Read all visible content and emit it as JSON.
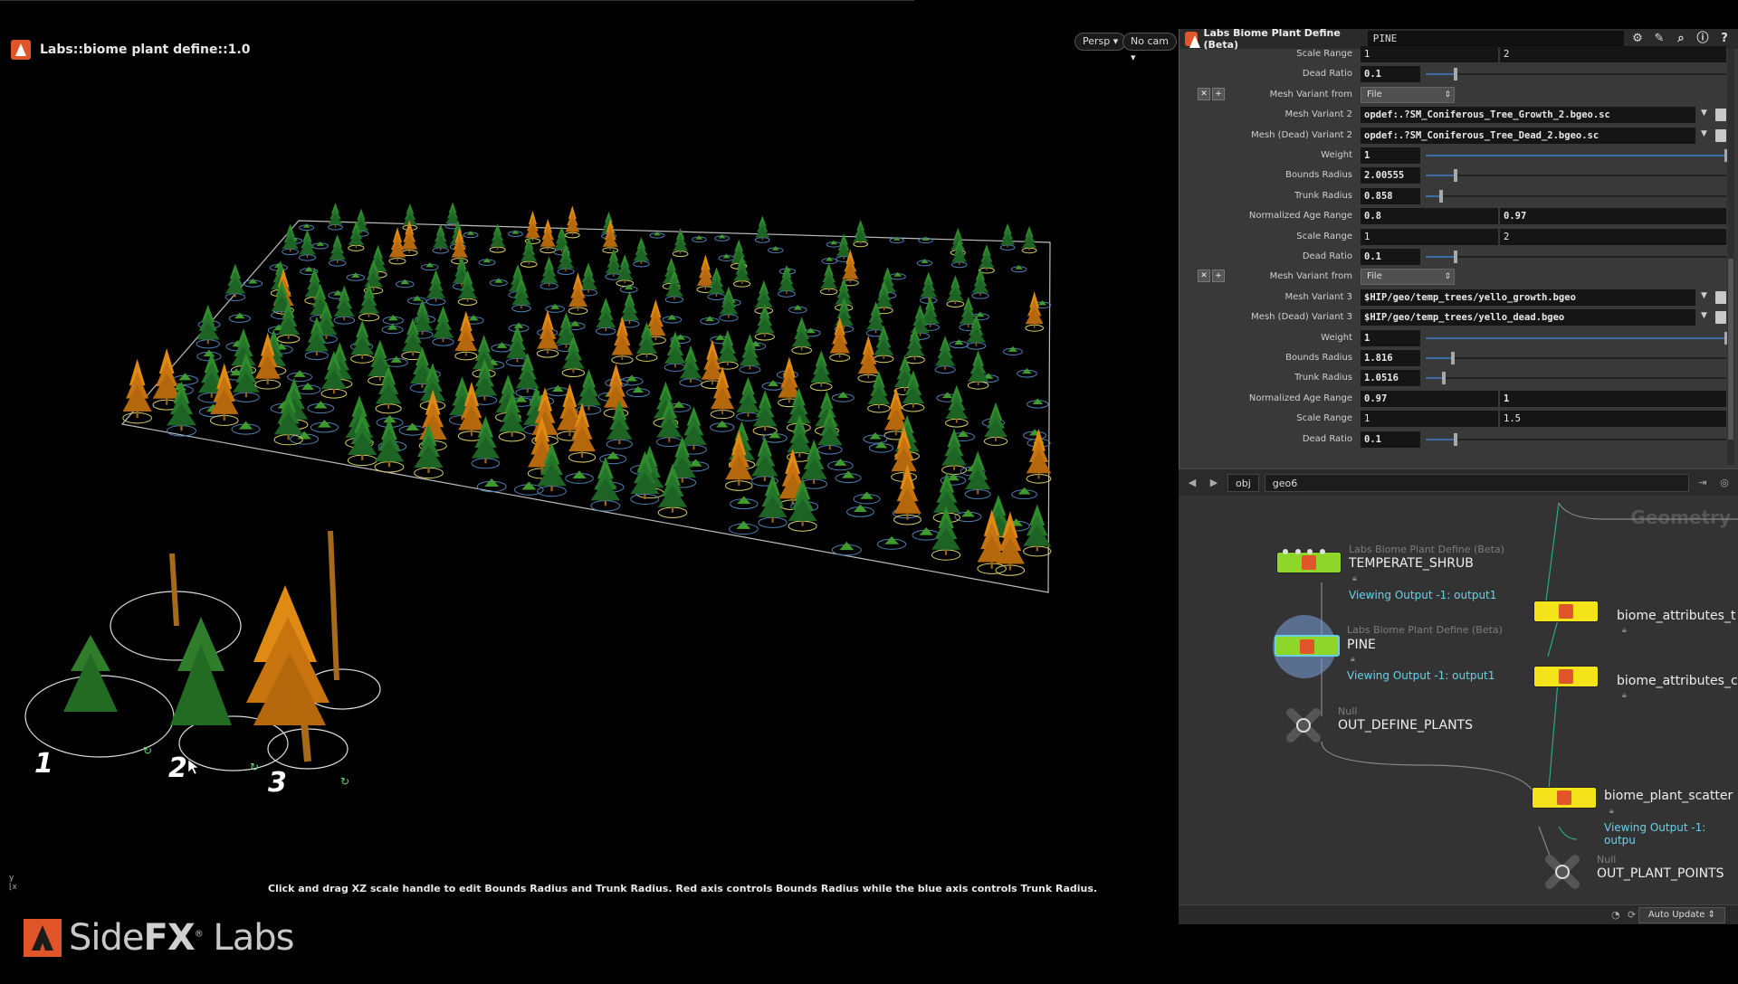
{
  "viewport": {
    "title": "Labs::biome plant define::1.0",
    "persp_label": "Persp",
    "cam_label": "No cam",
    "hint": "Click and drag XZ scale handle to edit Bounds Radius and Trunk Radius. Red axis controls Bounds Radius while the blue axis controls Trunk Radius.",
    "digits": [
      "1",
      "2",
      "3"
    ],
    "axis_y": "y",
    "axis_x": "x"
  },
  "param_panel": {
    "node_type": "Labs Biome Plant Define (Beta)",
    "node_name": "PINE",
    "icons": [
      "gear-icon",
      "brush-icon",
      "search-icon",
      "info-icon",
      "help-icon"
    ],
    "rows": [
      {
        "label": "Scale Range",
        "v1": "1",
        "v2": "2"
      },
      {
        "label": "Dead Ratio",
        "v1": "0.1",
        "slider": 0.1
      },
      {
        "label": "Mesh Variant from",
        "combo": "File"
      },
      {
        "label": "Mesh Variant 2",
        "path": "opdef:.?SM_Coniferous_Tree_Growth_2.bgeo.sc"
      },
      {
        "label": "Mesh (Dead) Variant 2",
        "path": "opdef:.?SM_Coniferous_Tree_Dead_2.bgeo.sc"
      },
      {
        "label": "Weight",
        "v1": "1",
        "slider": 1.0
      },
      {
        "label": "Bounds Radius",
        "v1": "2.00555",
        "slider": 0.1
      },
      {
        "label": "Trunk Radius",
        "v1": "0.858",
        "slider": 0.05
      },
      {
        "label": "Normalized Age Range",
        "v1": "0.8",
        "v2": "0.97"
      },
      {
        "label": "Scale Range",
        "v1": "1",
        "v2": "2"
      },
      {
        "label": "Dead Ratio",
        "v1": "0.1",
        "slider": 0.1
      },
      {
        "label": "Mesh Variant from",
        "combo": "File"
      },
      {
        "label": "Mesh Variant 3",
        "path": "$HIP/geo/temp_trees/yello_growth.bgeo"
      },
      {
        "label": "Mesh (Dead) Variant 3",
        "path": "$HIP/geo/temp_trees/yello_dead.bgeo"
      },
      {
        "label": "Weight",
        "v1": "1",
        "slider": 1.0
      },
      {
        "label": "Bounds Radius",
        "v1": "1.816",
        "slider": 0.09
      },
      {
        "label": "Trunk Radius",
        "v1": "1.0516",
        "slider": 0.06
      },
      {
        "label": "Normalized Age Range",
        "v1": "0.97",
        "v2": "1"
      },
      {
        "label": "Scale Range",
        "v1": "1",
        "v2": "1.5"
      },
      {
        "label": "Dead Ratio",
        "v1": "0.1",
        "slider": 0.1
      }
    ]
  },
  "net_path": {
    "obj": "obj",
    "geo": "geo6"
  },
  "network": {
    "ghost_label": "Geometry",
    "nodes": {
      "shrub": {
        "type": "Labs Biome Plant Define (Beta)",
        "name": "TEMPERATE_SHRUB",
        "viewing": "Viewing Output -1: output1"
      },
      "pine": {
        "type": "Labs Biome Plant Define (Beta)",
        "name": "PINE",
        "viewing": "Viewing Output -1: output1"
      },
      "out_define": {
        "type": "Null",
        "name": "OUT_DEFINE_PLANTS"
      },
      "attrs1": {
        "name": "biome_attributes_t"
      },
      "attrs2": {
        "name": "biome_attributes_c"
      },
      "scatter": {
        "name": "biome_plant_scatter",
        "viewing": "Viewing Output -1: outpu"
      },
      "out_points": {
        "type": "Null",
        "name": "OUT_PLANT_POINTS"
      }
    }
  },
  "statusbar": {
    "auto_update": "Auto Update"
  },
  "brand": {
    "side": "Side",
    "fx": "FX",
    "labs": "Labs"
  },
  "colors": {
    "node_yellow": "#f4e21a",
    "node_green": "#8ed62a",
    "viewing_cyan": "#6bd0e6",
    "houdini_orange": "#e0552a"
  }
}
